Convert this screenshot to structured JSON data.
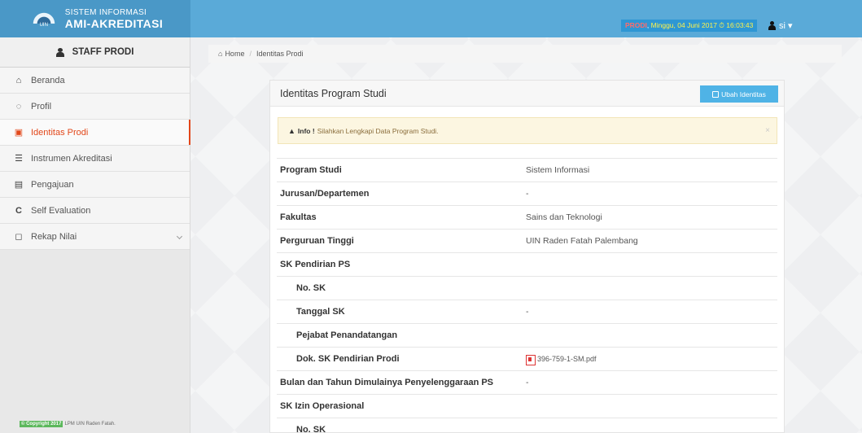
{
  "header": {
    "brand_line1": "SISTEM INFORMASI",
    "brand_line2": "AMI-AKREDITASI",
    "logo_text": "UIN",
    "status_role": "PRODI",
    "status_datetime": "Minggu, 04 Juni 2017 ⏱ 16:03:43",
    "user_name": "si ▾"
  },
  "sidebar": {
    "heading": "STAFF PRODI",
    "items": [
      {
        "label": "Beranda",
        "icon": "home-icon",
        "glyph": "⌂"
      },
      {
        "label": "Profil",
        "icon": "user-circle-icon",
        "glyph": "◌"
      },
      {
        "label": "Identitas Prodi",
        "icon": "id-card-icon",
        "glyph": "▣"
      },
      {
        "label": "Instrumen Akreditasi",
        "icon": "list-icon",
        "glyph": "☰"
      },
      {
        "label": "Pengajuan",
        "icon": "copy-icon",
        "glyph": "▤"
      },
      {
        "label": "Self Evaluation",
        "icon": "refresh-icon",
        "glyph": "C"
      },
      {
        "label": "Rekap Nilai",
        "icon": "clone-icon",
        "glyph": "◻"
      }
    ],
    "copyright_badge": "© Copyright 2017",
    "copyright_text": "LPM UIN Raden Fatah."
  },
  "breadcrumb": {
    "home": "Home",
    "current": "Identitas Prodi"
  },
  "panel": {
    "title": "Identitas Program Studi",
    "edit_button": "Ubah Identitas",
    "alert_strong": "Info !",
    "alert_text": "Silahkan Lengkapi Data Program Studi.",
    "alert_close": "×",
    "rows": [
      {
        "label": "Program Studi",
        "value": "Sistem Informasi"
      },
      {
        "label": "Jurusan/Departemen",
        "value": "-"
      },
      {
        "label": "Fakultas",
        "value": "Sains dan Teknologi"
      },
      {
        "label": "Perguruan Tinggi",
        "value": "UIN Raden Fatah Palembang"
      },
      {
        "label": "SK Pendirian PS",
        "value": ""
      },
      {
        "label": "No. SK",
        "value": ""
      },
      {
        "label": "Tanggal SK",
        "value": "-"
      },
      {
        "label": "Pejabat Penandatangan",
        "value": ""
      },
      {
        "label": "Dok. SK Pendirian Prodi",
        "value": "396-759-1-SM.pdf"
      },
      {
        "label": "Bulan dan Tahun Dimulainya Penyelenggaraan PS",
        "value": "-"
      },
      {
        "label": "SK Izin Operasional",
        "value": ""
      },
      {
        "label": "No. SK",
        "value": ""
      }
    ]
  }
}
